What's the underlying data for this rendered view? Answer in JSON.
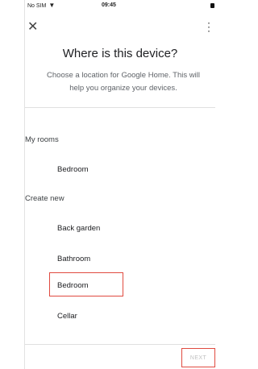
{
  "status_bar": {
    "carrier": "No SIM",
    "time": "09:45"
  },
  "header": {
    "title": "Where is this device?",
    "subtitle_line1": "Choose a location for Google Home. This will",
    "subtitle_line2": "help you organize your devices."
  },
  "sections": {
    "my_rooms": "My rooms",
    "create_new": "Create new"
  },
  "my_rooms_items": [
    "Bedroom"
  ],
  "create_new_items": [
    "Back garden",
    "Bathroom",
    "Bedroom",
    "Cellar"
  ],
  "selected_item": "Bedroom",
  "footer": {
    "next_label": "NEXT"
  },
  "icons": {
    "close": "close-icon",
    "more": "more-vert-icon",
    "wifi": "wifi-icon"
  },
  "colors": {
    "highlight": "#e04a3f",
    "disabled_text": "#c0c0c0"
  }
}
